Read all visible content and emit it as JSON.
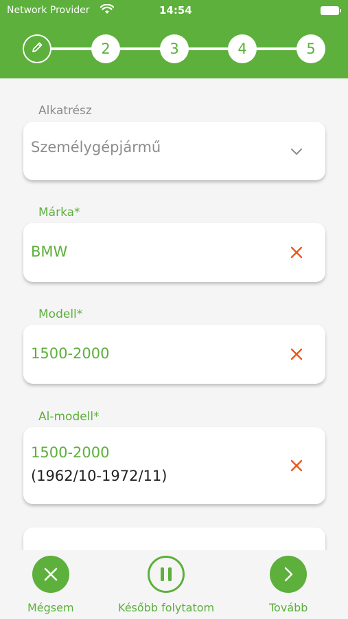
{
  "status_bar": {
    "carrier": "Network Provider",
    "time": "14:54"
  },
  "stepper": {
    "steps": [
      "2",
      "3",
      "4",
      "5"
    ]
  },
  "form": {
    "part": {
      "label": "Alkatrész",
      "value": "Személygépjármű"
    },
    "brand": {
      "label": "Márka*",
      "value": "BMW"
    },
    "model": {
      "label": "Modell*",
      "value": "1500-2000"
    },
    "submodel": {
      "label": "Al-modell*",
      "value": "1500-2000",
      "detail": "(1962/10-1972/11)"
    }
  },
  "actions": {
    "cancel": "Mégsem",
    "later": "Később folytatom",
    "next": "Tovább"
  },
  "colors": {
    "accent": "#5cb03b",
    "clear_icon": "#e8591c",
    "muted_text": "#8c8c8c"
  }
}
